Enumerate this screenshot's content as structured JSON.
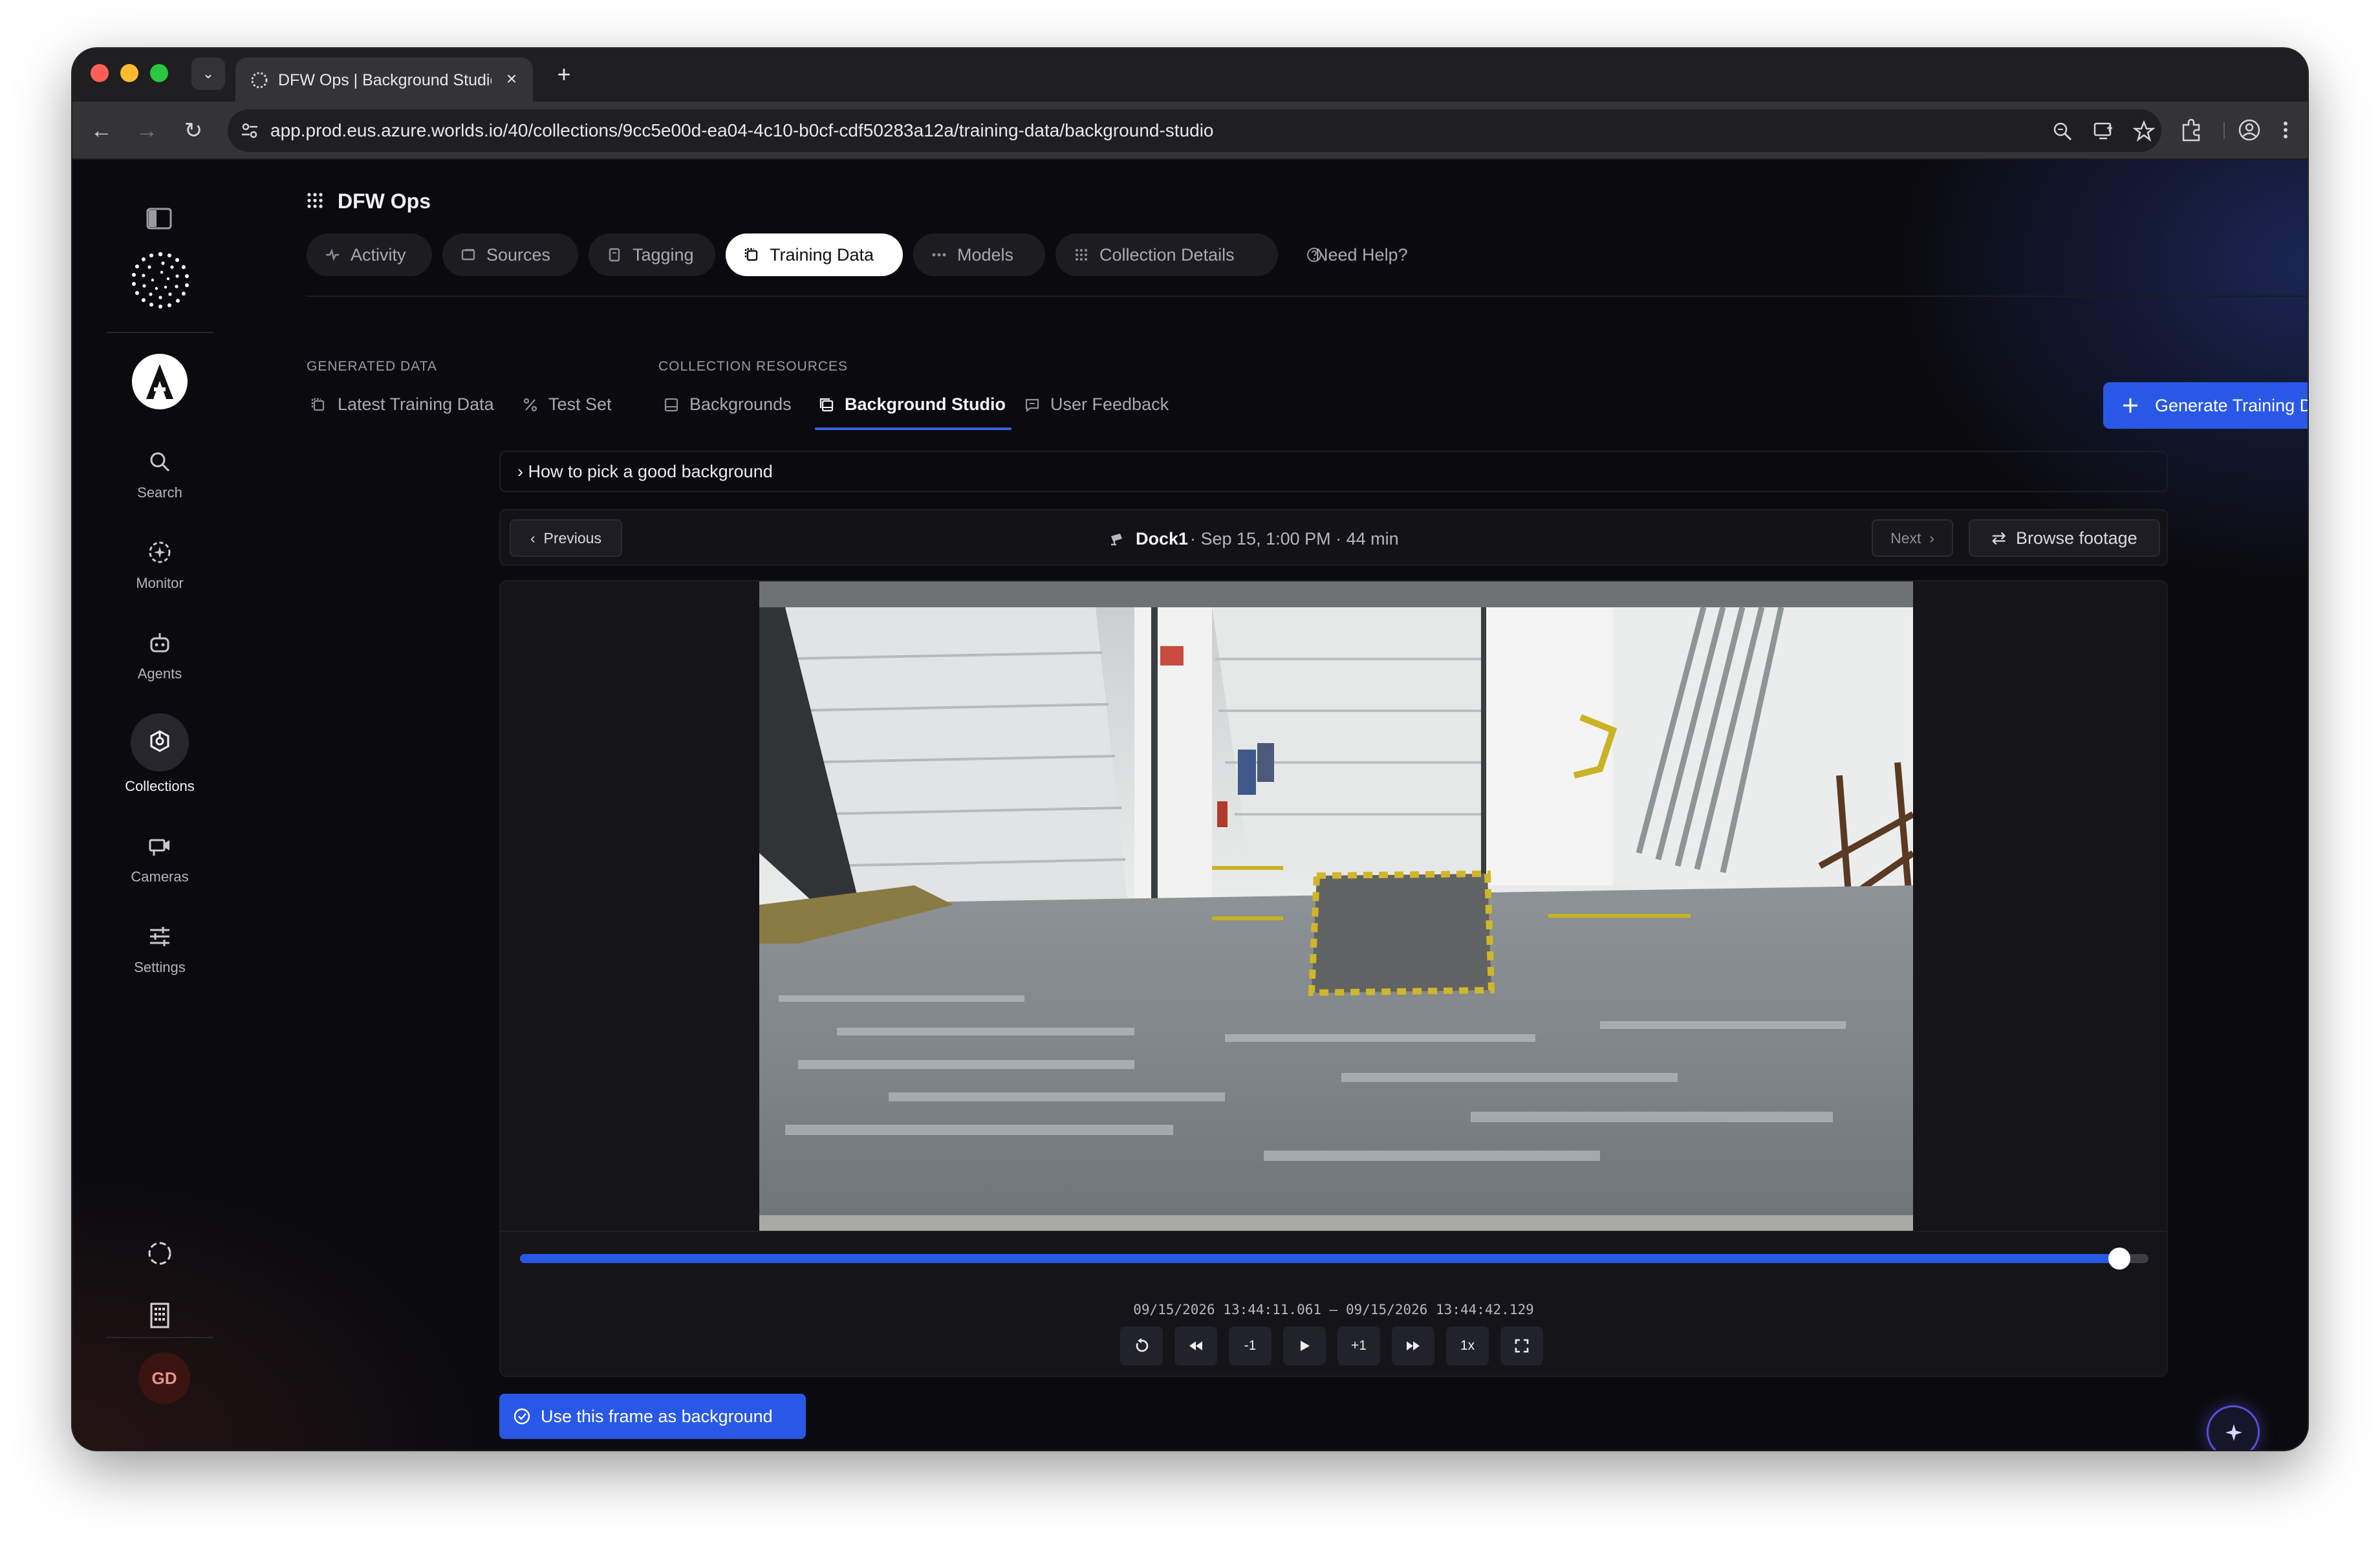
{
  "browser": {
    "tab_title": "DFW Ops | Background Studio",
    "url": "app.prod.eus.azure.worlds.io/40/collections/9cc5e00d-ea04-4c10-b0cf-cdf50283a12a/training-data/background-studio",
    "close_glyph": "×",
    "new_tab_glyph": "+",
    "back_glyph": "←",
    "forward_glyph": "→",
    "reload_glyph": "↻",
    "dropdown_glyph": "⌄"
  },
  "sidebar": {
    "items": [
      {
        "label": "Search",
        "icon": "search-icon"
      },
      {
        "label": "Monitor",
        "icon": "monitor-icon"
      },
      {
        "label": "Agents",
        "icon": "robot-icon"
      },
      {
        "label": "Collections",
        "icon": "collections-icon"
      },
      {
        "label": "Cameras",
        "icon": "camera-icon"
      },
      {
        "label": "Settings",
        "icon": "sliders-icon"
      }
    ],
    "user_initials": "GD"
  },
  "header": {
    "org_name": "DFW Ops",
    "tabs": [
      {
        "label": "Activity",
        "icon": "activity-icon"
      },
      {
        "label": "Sources",
        "icon": "sources-icon"
      },
      {
        "label": "Tagging",
        "icon": "tag-icon"
      },
      {
        "label": "Training Data",
        "icon": "training-data-icon"
      },
      {
        "label": "Models",
        "icon": "models-icon"
      },
      {
        "label": "Collection Details",
        "icon": "details-icon"
      },
      {
        "label": "Need Help?",
        "icon": "help-icon"
      }
    ],
    "active_tab": "Training Data"
  },
  "subnav": {
    "generated_label": "GENERATED DATA",
    "resources_label": "COLLECTION RESOURCES",
    "items": [
      {
        "label": "Latest Training Data"
      },
      {
        "label": "Test Set"
      },
      {
        "label": "Backgrounds"
      },
      {
        "label": "Background Studio"
      },
      {
        "label": "User Feedback"
      }
    ],
    "active": "Background Studio",
    "generate_button": "Generate Training Data"
  },
  "content": {
    "howto_label": "› How to pick a good background",
    "previous_label": "Previous",
    "next_label": "Next",
    "browse_label": "Browse footage",
    "camera_name": "Dock1",
    "clip_meta": "· Sep 15, 1:00 PM · 44 min",
    "timeline_progress": 0.982,
    "time_range": "09/15/2026 13:44:11.061 – 09/15/2026 13:44:42.129",
    "controls": [
      {
        "name": "restart-button",
        "label": ""
      },
      {
        "name": "rewind-button",
        "label": ""
      },
      {
        "name": "step-back-button",
        "label": "-1"
      },
      {
        "name": "play-button",
        "label": ""
      },
      {
        "name": "step-forward-button",
        "label": "+1"
      },
      {
        "name": "fast-forward-button",
        "label": ""
      },
      {
        "name": "speed-button",
        "label": "1x"
      },
      {
        "name": "fullscreen-button",
        "label": ""
      }
    ],
    "use_frame_label": "Use this frame as background"
  },
  "colors": {
    "accent": "#2a58e6",
    "active_underline": "#3b63e6",
    "background": "#0b0b0f"
  }
}
